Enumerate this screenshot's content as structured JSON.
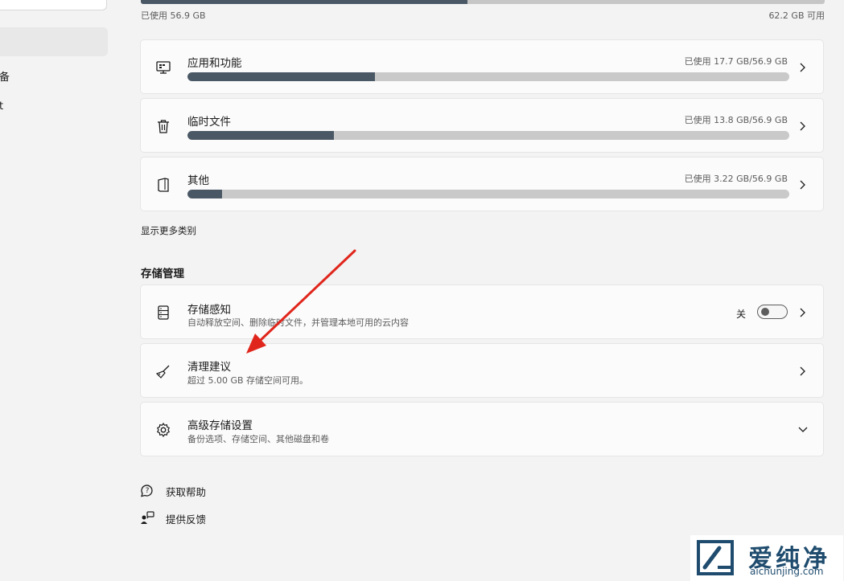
{
  "nav": {
    "items": [
      {
        "label": "备"
      },
      {
        "label": "t"
      }
    ]
  },
  "storage_total": {
    "used_text": "已使用 56.9 GB",
    "free_text": "62.2 GB 可用",
    "used_fraction": 0.478
  },
  "categories": [
    {
      "title": "应用和功能",
      "usage": "已使用 17.7 GB/56.9 GB",
      "fraction": 0.311,
      "icon": "desktop-apps-icon"
    },
    {
      "title": "临时文件",
      "usage": "已使用 13.8 GB/56.9 GB",
      "fraction": 0.243,
      "icon": "trash-icon"
    },
    {
      "title": "其他",
      "usage": "已使用 3.22 GB/56.9 GB",
      "fraction": 0.057,
      "icon": "document-icon"
    }
  ],
  "show_more_label": "显示更多类别",
  "management": {
    "title": "存储管理",
    "items": [
      {
        "title": "存储感知",
        "subtitle": "自动释放空间、删除临时文件，并管理本地可用的云内容",
        "toggle_label": "关",
        "toggle_on": false,
        "icon": "storage-icon"
      },
      {
        "title": "清理建议",
        "subtitle": "超过 5.00 GB 存储空间可用。",
        "icon": "broom-icon"
      },
      {
        "title": "高级存储设置",
        "subtitle": "备份选项、存储空间、其他磁盘和卷",
        "icon": "gear-icon"
      }
    ]
  },
  "footer": {
    "help_label": "获取帮助",
    "feedback_label": "提供反馈"
  },
  "watermark": {
    "cn": "爱纯净",
    "en": "aichunjing.com"
  },
  "colors": {
    "bar_fill": "#4a5866",
    "bar_track": "#c9c9c9",
    "annotation_arrow": "#e0261c"
  }
}
